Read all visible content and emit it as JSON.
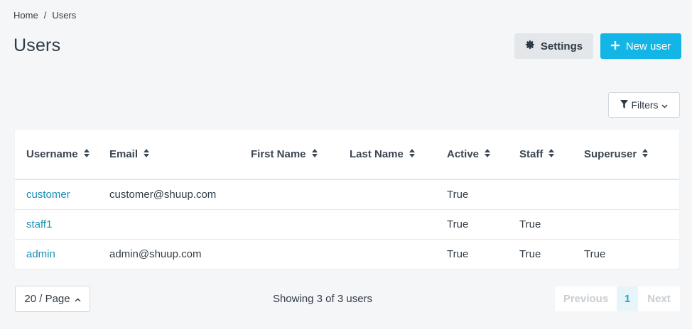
{
  "breadcrumb": {
    "home": "Home",
    "separator": "/",
    "current": "Users"
  },
  "page_title": "Users",
  "toolbar": {
    "settings_label": "Settings",
    "settings_icon": "gear-icon",
    "new_user_label": "New user",
    "new_user_icon": "plus-icon",
    "filters_label": "Filters",
    "filters_icon": "filter-icon"
  },
  "colors": {
    "accent": "#12b5e5",
    "link": "#1a8fb4",
    "background": "#f4f6f8"
  },
  "table": {
    "columns": [
      "Username",
      "Email",
      "First Name",
      "Last Name",
      "Active",
      "Staff",
      "Superuser"
    ],
    "rows": [
      [
        "customer",
        "customer@shuup.com",
        "",
        "",
        "True",
        "",
        ""
      ],
      [
        "staff1",
        "",
        "",
        "",
        "True",
        "True",
        ""
      ],
      [
        "admin",
        "admin@shuup.com",
        "",
        "",
        "True",
        "True",
        "True"
      ]
    ]
  },
  "footer": {
    "per_page": "20 / Page",
    "showing": "Showing 3 of 3 users",
    "pagination": {
      "previous": "Previous",
      "current_page": "1",
      "next": "Next"
    }
  }
}
